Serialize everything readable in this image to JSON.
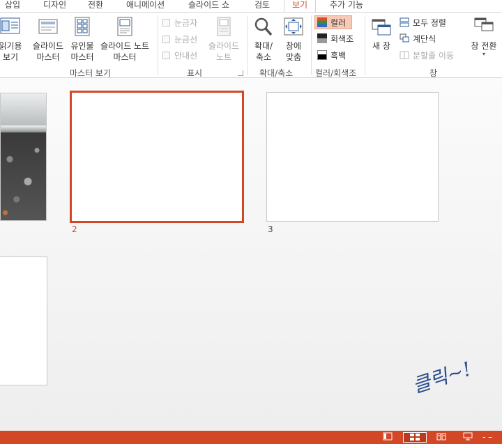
{
  "tabs": [
    "삽입",
    "디자인",
    "전환",
    "애니메이션",
    "슬라이드 쇼",
    "검토",
    "보기",
    "추가 기능"
  ],
  "ribbon": {
    "reading_view": "읽기용\n보기",
    "slide_master": "슬라이드\n마스터",
    "handout_master": "유인물\n마스터",
    "notes_master": "슬라이드 노트\n마스터",
    "group_master": "마스터 보기",
    "ruler": "눈금자",
    "gridlines": "눈금선",
    "guides": "안내선",
    "notes": "슬라이드\n노트",
    "group_show": "표시",
    "zoom": "확대/\n축소",
    "fit_window": "창에\n맞춤",
    "group_zoom": "확대/축소",
    "color": "컬러",
    "grayscale": "회색조",
    "black_white": "흑백",
    "group_color": "컬러/회색조",
    "new_window": "새 창",
    "arrange_all": "모두 정렬",
    "cascade": "계단식",
    "move_split": "분할줄 이동",
    "switch_windows": "창 전환",
    "group_window": "창"
  },
  "slides": [
    {
      "number": "2",
      "selected": true
    },
    {
      "number": "3",
      "selected": false
    }
  ],
  "annotation": "클릭~!",
  "colors": {
    "accent": "#d24726",
    "annotation": "#2b4d8f"
  }
}
